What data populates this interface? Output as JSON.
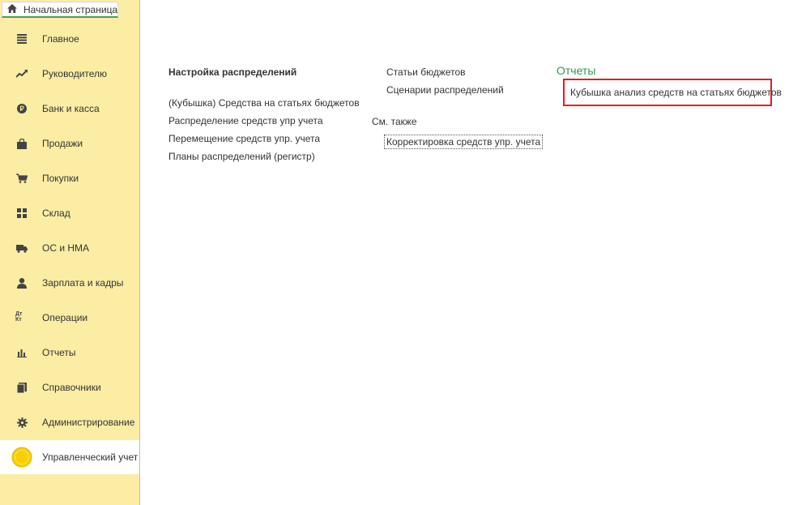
{
  "tabs": {
    "home_label": "Начальная страница"
  },
  "sidebar": {
    "items": [
      {
        "label": "Главное",
        "icon": "menu-lines-icon"
      },
      {
        "label": "Руководителю",
        "icon": "trend-icon"
      },
      {
        "label": "Банк и касса",
        "icon": "ruble-coin-icon"
      },
      {
        "label": "Продажи",
        "icon": "shopping-bag-icon"
      },
      {
        "label": "Покупки",
        "icon": "cart-icon"
      },
      {
        "label": "Склад",
        "icon": "warehouse-grid-icon"
      },
      {
        "label": "ОС и НМА",
        "icon": "truck-icon"
      },
      {
        "label": "Зарплата и кадры",
        "icon": "person-icon"
      },
      {
        "label": "Операции",
        "icon": "dt-kt-icon"
      },
      {
        "label": "Отчеты",
        "icon": "bar-chart-icon"
      },
      {
        "label": "Справочники",
        "icon": "books-icon"
      },
      {
        "label": "Администрирование",
        "icon": "gear-icon"
      },
      {
        "label": "Управленческий учет",
        "icon": "yellow-circle-icon",
        "active": true
      }
    ],
    "icon_glyphs": {
      "dt_kt": "Дт Кт"
    }
  },
  "content": {
    "col1": {
      "heading": "Настройка распределений",
      "links": [
        "(Кубышка) Средства на статьях бюджетов",
        "Распределение средств упр учета",
        "Перемещение средств упр. учета",
        "Планы распределений (регистр)"
      ]
    },
    "col2": {
      "links": [
        "Статьи бюджетов",
        "Сценарии распределений"
      ],
      "see_also_label": "См. также",
      "see_also_link": "Корректировка средств упр. учета"
    },
    "col3": {
      "title": "Отчеты",
      "links": [
        "Кубышка анализ средств на статьях бюджетов"
      ]
    }
  },
  "colors": {
    "sidebar_bg": "#fbeda4",
    "reports_title": "#2b9a4a",
    "highlight_border": "#e02020",
    "active_tab_underline": "#4c9a5a"
  }
}
